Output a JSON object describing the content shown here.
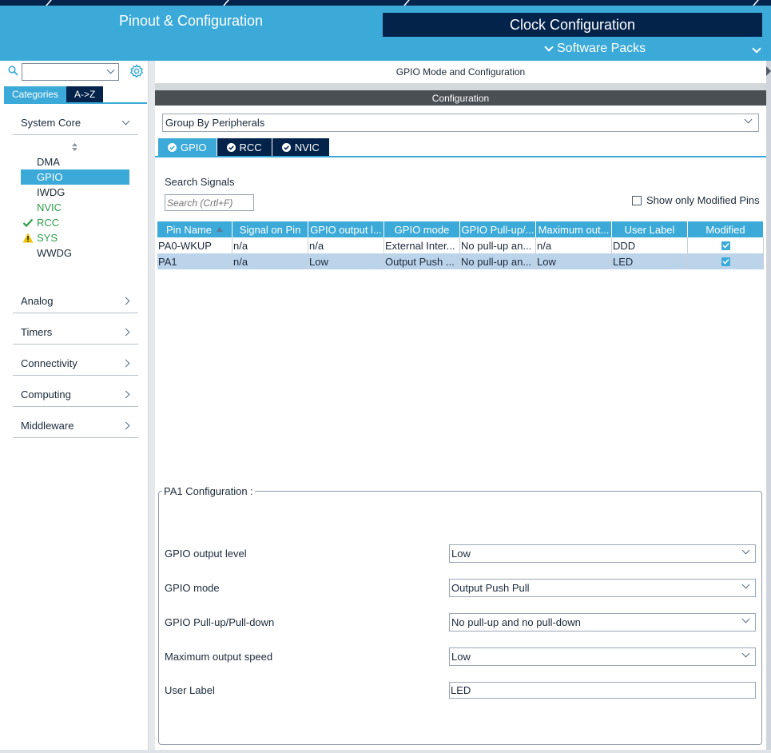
{
  "header": {
    "tab_pinout": "Pinout & Configuration",
    "tab_clock": "Clock Configuration",
    "software_packs": "Software Packs"
  },
  "sidebar": {
    "search_value": "",
    "tabs": [
      "Categories",
      "A->Z"
    ],
    "sections": {
      "system_core": "System Core",
      "analog": "Analog",
      "timers": "Timers",
      "connectivity": "Connectivity",
      "computing": "Computing",
      "middleware": "Middleware"
    },
    "peripherals": [
      {
        "label": "DMA",
        "status": "none"
      },
      {
        "label": "GPIO",
        "status": "selected"
      },
      {
        "label": "IWDG",
        "status": "none"
      },
      {
        "label": "NVIC",
        "status": "configured"
      },
      {
        "label": "RCC",
        "status": "ok"
      },
      {
        "label": "SYS",
        "status": "warning"
      },
      {
        "label": "WWDG",
        "status": "none"
      }
    ]
  },
  "main": {
    "mode_title": "GPIO Mode and Configuration",
    "config_title": "Configuration",
    "group_by": "Group By Peripherals",
    "periph_tabs": [
      "GPIO",
      "RCC",
      "NVIC"
    ],
    "search_label": "Search Signals",
    "search_placeholder": "Search (Crtl+F)",
    "show_modified": "Show only Modified Pins",
    "table": {
      "headers": [
        "Pin Name",
        "Signal on Pin",
        "GPIO output l...",
        "GPIO mode",
        "GPIO Pull-up/...",
        "Maximum out...",
        "User Label",
        "Modified"
      ],
      "rows": [
        [
          "PA0-WKUP",
          "n/a",
          "n/a",
          "External Inter...",
          "No pull-up an...",
          "n/a",
          "DDD",
          true
        ],
        [
          "PA1",
          "n/a",
          "Low",
          "Output Push ...",
          "No pull-up an...",
          "Low",
          "LED",
          true
        ]
      ]
    },
    "pin_config": {
      "title": "PA1 Configuration :",
      "fields": {
        "output_level_label": "GPIO output level",
        "output_level_value": "Low",
        "mode_label": "GPIO mode",
        "mode_value": "Output Push Pull",
        "pull_label": "GPIO Pull-up/Pull-down",
        "pull_value": "No pull-up and no pull-down",
        "speed_label": "Maximum output speed",
        "speed_value": "Low",
        "user_label_label": "User Label",
        "user_label_value": "LED"
      }
    }
  },
  "colors": {
    "accent": "#3caad8",
    "navy": "#03234b",
    "ok_green": "#2e9e4a",
    "warning_yellow": "#f2c200",
    "selected_row": "#bcd4ea"
  }
}
